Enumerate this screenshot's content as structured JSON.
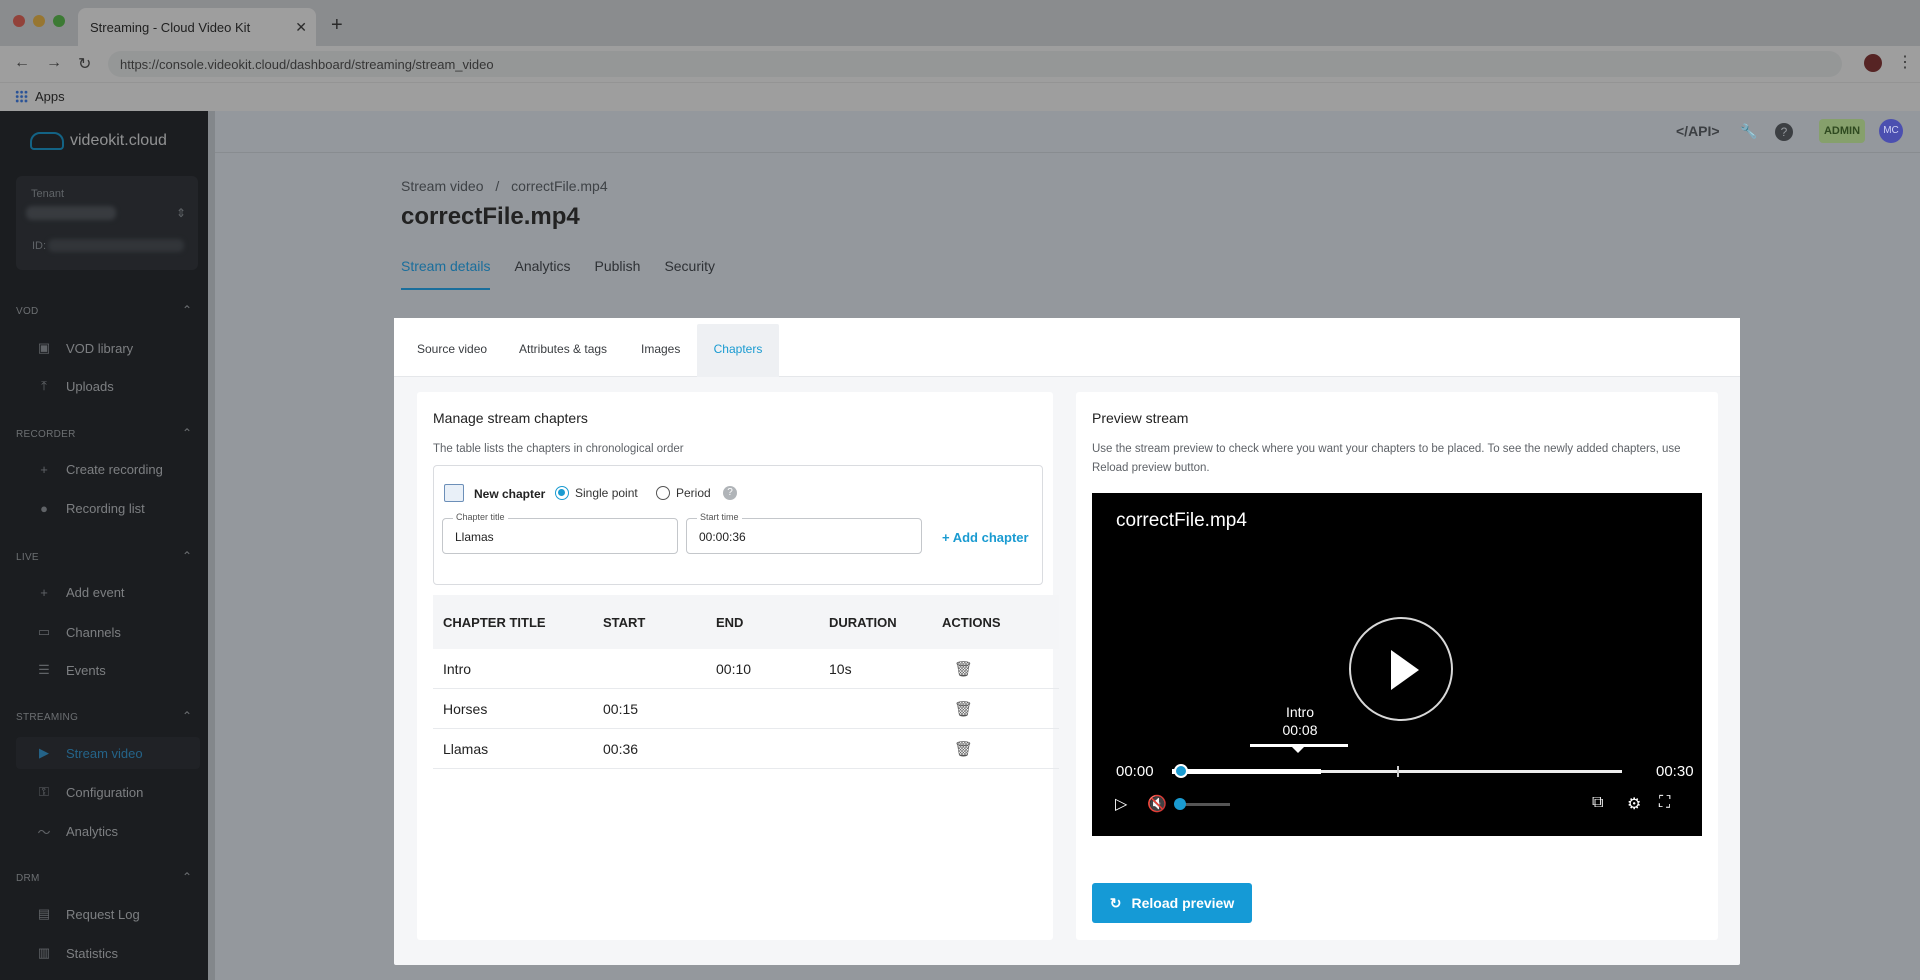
{
  "browser": {
    "tab_title": "Streaming - Cloud Video Kit",
    "url": "https://console.videokit.cloud/dashboard/streaming/stream_video",
    "bookmark_apps": "Apps"
  },
  "sidebar": {
    "brand": "videokit.cloud",
    "tenant_label": "Tenant",
    "tenant_id_label": "ID:",
    "sections": {
      "vod": "VOD",
      "recorder": "RECORDER",
      "live": "LIVE",
      "streaming": "STREAMING",
      "drm": "DRM"
    },
    "items": {
      "vod_library": "VOD library",
      "uploads": "Uploads",
      "create_recording": "Create recording",
      "recording_list": "Recording list",
      "add_event": "Add event",
      "channels": "Channels",
      "events": "Events",
      "stream_video": "Stream video",
      "configuration": "Configuration",
      "analytics": "Analytics",
      "request_log": "Request Log",
      "statistics": "Statistics"
    }
  },
  "topbar": {
    "api": "</API>",
    "admin_badge": "ADMIN",
    "avatar_initials": "MC"
  },
  "page": {
    "breadcrumb_root": "Stream video",
    "breadcrumb_sep": "/",
    "breadcrumb_current": "correctFile.mp4",
    "title": "correctFile.mp4",
    "tabs": [
      "Stream details",
      "Analytics",
      "Publish",
      "Security"
    ]
  },
  "modal": {
    "tabs": [
      "Source video",
      "Attributes & tags",
      "Images",
      "Chapters"
    ],
    "left": {
      "heading": "Manage stream chapters",
      "subtitle": "The table lists the chapters in chronological order",
      "new_chapter": "New chapter",
      "radio_single": "Single point",
      "radio_period": "Period",
      "help": "?",
      "chapter_title_label": "Chapter title",
      "chapter_title_value": "Llamas",
      "start_time_label": "Start time",
      "start_time_value": "00:00:36",
      "add_chapter": "+ Add chapter",
      "columns": [
        "CHAPTER TITLE",
        "START",
        "END",
        "DURATION",
        "ACTIONS"
      ],
      "rows": [
        {
          "title": "Intro",
          "start": "",
          "end": "00:10",
          "duration": "10s"
        },
        {
          "title": "Horses",
          "start": "00:15",
          "end": "",
          "duration": ""
        },
        {
          "title": "Llamas",
          "start": "00:36",
          "end": "",
          "duration": ""
        }
      ]
    },
    "right": {
      "heading": "Preview stream",
      "description": "Use the stream preview to check where you want your chapters to be placed. To see the newly added chapters, use Reload preview button.",
      "video_title": "correctFile.mp4",
      "tooltip_chapter": "Intro",
      "tooltip_time": "00:08",
      "current_time": "00:00",
      "duration": "00:30",
      "progress": 0.0,
      "buffered": 0.33,
      "volume": 0.0,
      "reload_button": "Reload preview"
    }
  },
  "colors": {
    "accent": "#1a9bd1",
    "sidebar_bg": "#2b2e33"
  }
}
